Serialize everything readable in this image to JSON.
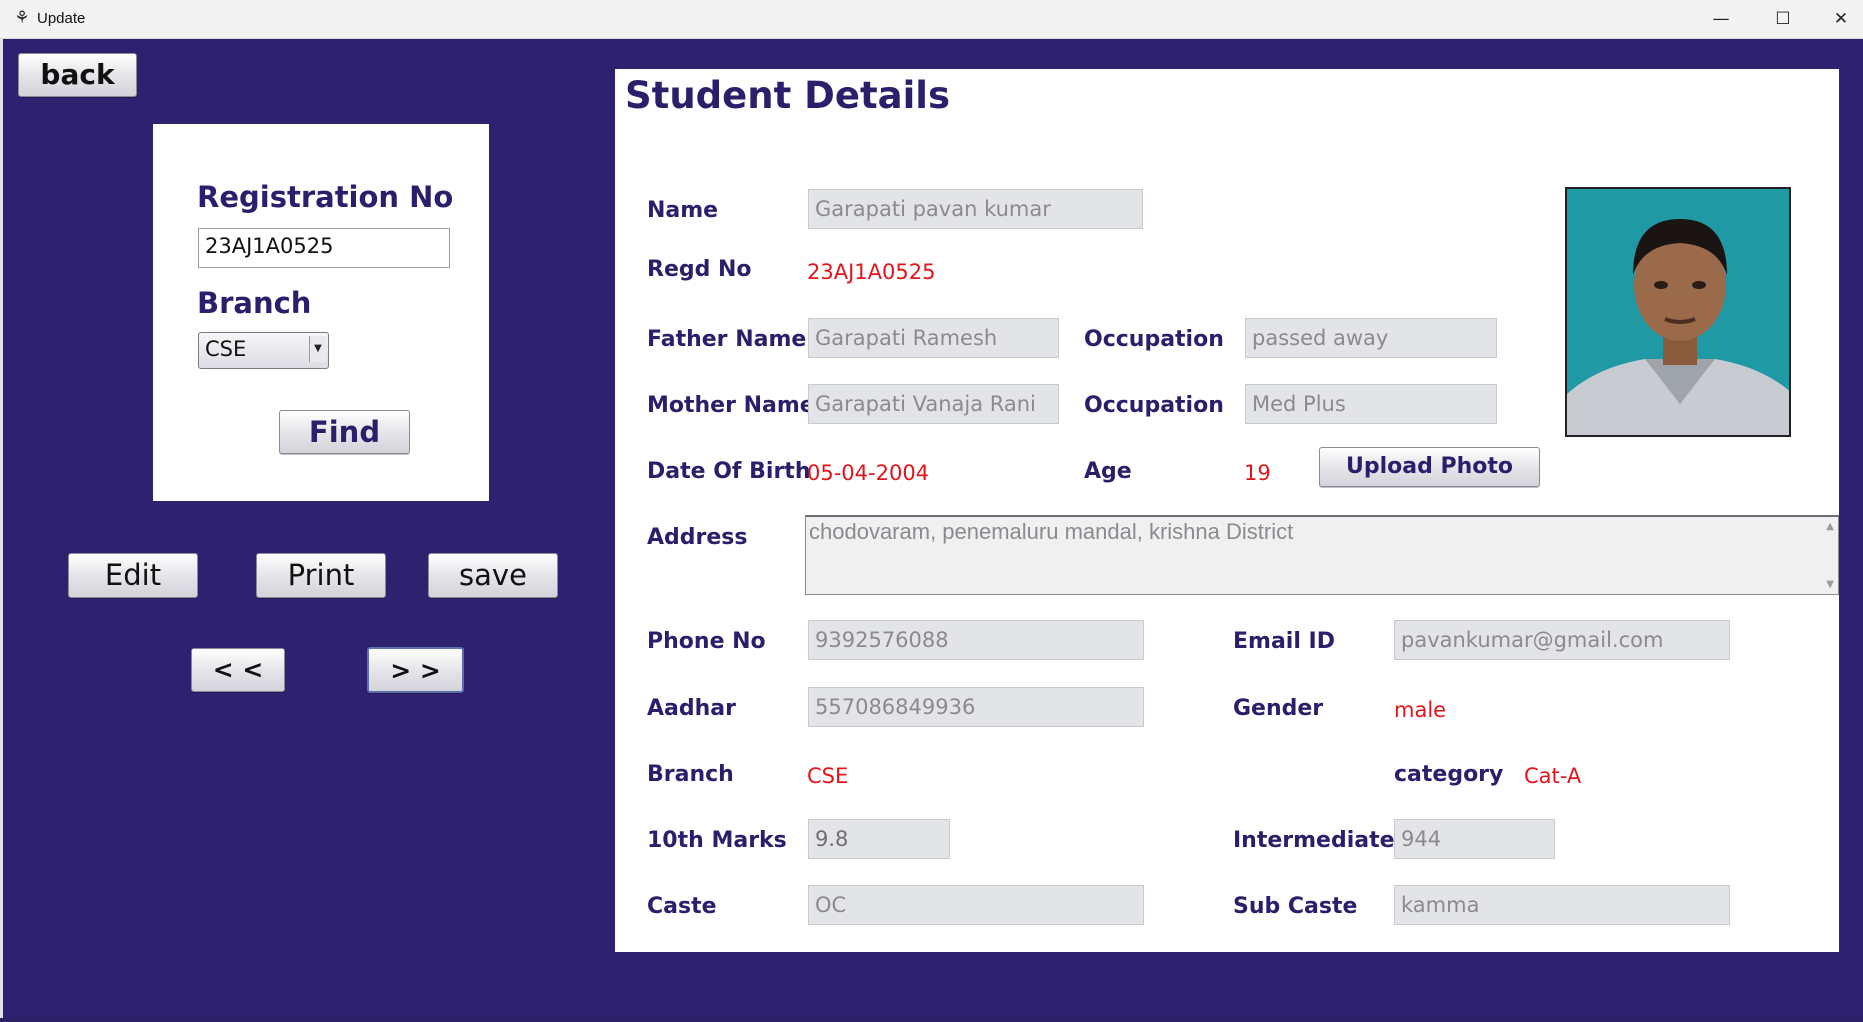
{
  "window": {
    "title": "Update",
    "minimize": "—",
    "maximize": "☐",
    "close": "✕"
  },
  "search": {
    "back_label": "back",
    "reg_label": "Registration No",
    "reg_value": "23AJ1A0525",
    "branch_label": "Branch",
    "branch_selected": "CSE",
    "find_label": "Find"
  },
  "actions": {
    "edit": "Edit",
    "print": "Print",
    "save": "save",
    "prev": "< <",
    "next": "> >"
  },
  "details": {
    "heading": "Student Details",
    "name_label": "Name",
    "name_value": "Garapati pavan kumar",
    "regd_label": "Regd No",
    "regd_value": "23AJ1A0525",
    "father_label": "Father Name",
    "father_value": "Garapati Ramesh",
    "father_occ_label": "Occupation",
    "father_occ_value": "passed away",
    "mother_label": "Mother Name",
    "mother_value": "Garapati Vanaja Rani",
    "mother_occ_label": "Occupation",
    "mother_occ_value": "Med Plus",
    "dob_label": "Date Of Birth",
    "dob_value": "05-04-2004",
    "age_label": "Age",
    "age_value": "19",
    "upload_label": "Upload Photo",
    "address_label": "Address",
    "address_value": "chodovaram, penemaluru mandal, krishna District",
    "phone_label": "Phone No",
    "phone_value": "9392576088",
    "email_label": "Email ID",
    "email_value": "pavankumar@gmail.com",
    "aadhar_label": "Aadhar",
    "aadhar_value": "557086849936",
    "gender_label": "Gender",
    "gender_value": "male",
    "branch_label": "Branch",
    "branch_value": "CSE",
    "category_label": "category",
    "category_value": "Cat-A",
    "tenth_label": "10th Marks",
    "tenth_value": "9.8",
    "inter_label": "Intermediate",
    "inter_value": "944",
    "caste_label": "Caste",
    "caste_value": "OC",
    "subcaste_label": "Sub Caste",
    "subcaste_value": "kamma"
  },
  "colors": {
    "background": "#2e2270",
    "label": "#2b1f6b",
    "highlight_value": "#e3141b",
    "field_bg": "#e3e4e8"
  }
}
